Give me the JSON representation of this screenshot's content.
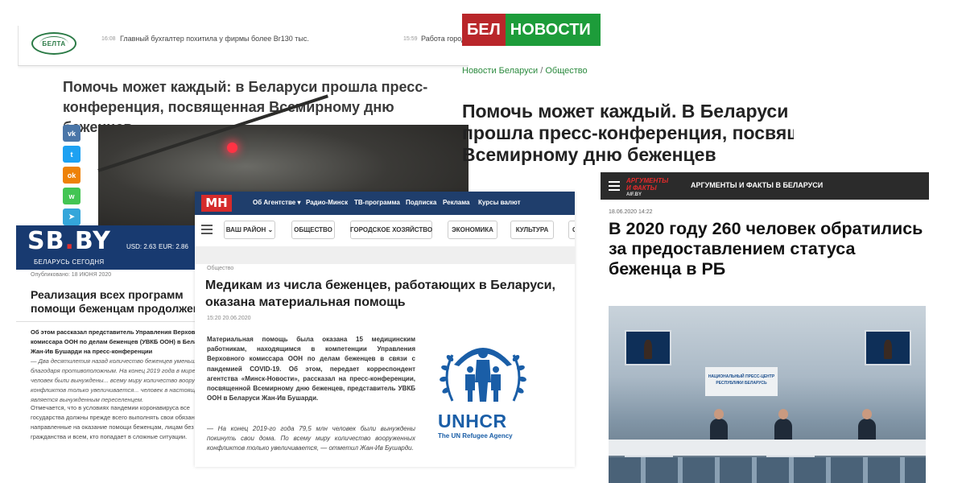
{
  "belta": {
    "logo_text": "БЕЛТА",
    "ticker": [
      {
        "time": "16:08",
        "text": "Главный бухгалтер похитила у фирмы более Br130 тыс."
      },
      {
        "time": "15:59",
        "text": "Работа город"
      }
    ],
    "title": "Помочь может каждый: в Беларуси прошла пресс-конференция, посвященная Всемирному дню беженцев",
    "share": [
      {
        "icon": "vk-icon",
        "label": "vk",
        "color": "#4a76a8"
      },
      {
        "icon": "twitter-icon",
        "label": "t",
        "color": "#1da1f2"
      },
      {
        "icon": "odnoklassniki-icon",
        "label": "ok",
        "color": "#ee8208"
      },
      {
        "icon": "whatsapp-icon",
        "label": "w",
        "color": "#43c553"
      },
      {
        "icon": "telegram-icon",
        "label": "➤",
        "color": "#34a6da"
      }
    ]
  },
  "belnovosti": {
    "logo_red": "БЕЛ",
    "logo_green": "НОВОСТИ",
    "breadcrumb_home": "Новости Беларуси",
    "breadcrumb_sep": "/",
    "breadcrumb_section": "Общество",
    "title": "Помочь может каждый. В Беларуси прошла пресс-конференция, посвященная Всемирному дню беженцев"
  },
  "sb": {
    "logo_left": "SB",
    "logo_dot": ".",
    "logo_right": "BY",
    "subtitle": "БЕЛАРУСЬ СЕГОДНЯ",
    "usd": "USD: 2.63",
    "eur": "EUR: 2.86",
    "published": "Опубликовано: 18 ИЮНЯ 2020",
    "title": "Реализация всех программ помощи беженцам продолжена",
    "lead": "Об этом рассказал представитель Управления Верховного комиссара ООН по делам беженцев (УВКБ ООН) в Беларуси Жан-Ив Бушарди на пресс-конференции",
    "quote": "— Два десятилетия назад количество беженцев уменьшилось благодаря противоположным. На конец 2019 года в мире 79,5 млн человек были вынуждены... всему миру количество вооруженных конфликтов только увеличивается... человек в настоящее время является вынужденным переселенцем.",
    "para": "Отмечается, что в условиях пандемии коронавируса все государства должны прежде всего выполнять свои обязанности, направленные на оказание помощи беженцам, лицам без гражданства и всем, кто попадает в сложные ситуации."
  },
  "mn": {
    "logo": "МН",
    "nav": [
      "Об Агентстве ▾",
      "Радио-Минск",
      "ТВ-программа",
      "Подписка",
      "Реклама",
      "Курсы валют"
    ],
    "categories": [
      "ВАШ РАЙОН ⌄",
      "ОБЩЕСТВО",
      "ГОРОДСКОЕ ХОЗЯЙСТВО",
      "ЭКОНОМИКА",
      "КУЛЬТУРА",
      "С"
    ],
    "rubric": "Общество",
    "title": "Медикам из числа беженцев, работающих в Беларуси, оказана материальная помощь",
    "date": "15:20 20.06.2020",
    "lead": "Материальная помощь была оказана 15 медицинским работникам, находящимся в компетенции Управления Верховного комиссара ООН по делам беженцев в связи с пандемией COVID-19. Об этом, передает корреспондент агентства «Минск-Новости», рассказал на пресс-конференции, посвященной Всемирному дню беженцев, представитель УВКБ ООН в Беларуси Жан-Ив Бушарди.",
    "quote": "— На конец 2019-го года 79,5 млн человек были вынуждены покинуть свои дома. По всему миру количество вооруженных конфликтов только увеличивается, — отметил Жан-Ив Бушарди.",
    "unhcr_word": "UNHCR",
    "unhcr_tag": "The UN Refugee Agency",
    "unhcr_color": "#1a5ea7"
  },
  "aif": {
    "logo_top": "АРГУМЕНТЫ",
    "logo_bottom": "И ФАКТЫ",
    "logo_domain": "AIF.BY",
    "header_title": "АРГУМЕНТЫ И ФАКТЫ В БЕЛАРУСИ",
    "date": "18.06.2020 14:22",
    "title": "В 2020 году 260 человек обратились за предоставлением статуса беженца в РБ",
    "banner": "НАЦИОНАЛЬНЫЙ ПРЕСС-ЦЕНТР РЕСПУБЛИКИ БЕЛАРУСЬ"
  }
}
